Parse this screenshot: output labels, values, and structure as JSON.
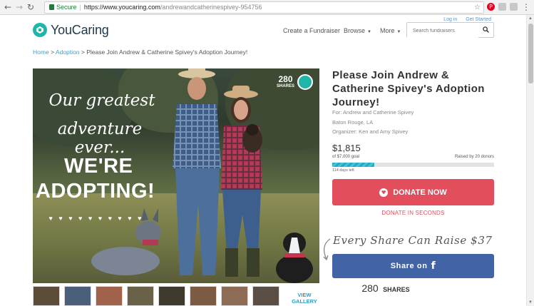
{
  "browser": {
    "secure_label": "Secure",
    "url_host": "https://www.youcaring.com",
    "url_path": "/andrewandcatherinespivey-954756"
  },
  "header": {
    "login": "Log in",
    "get_started": "Get Started",
    "logo_text": "YouCaring",
    "nav": {
      "create": "Create a Fundraiser",
      "browse": "Browse",
      "more": "More"
    },
    "search_placeholder": "Search fundraisers"
  },
  "breadcrumb": {
    "home": "Home",
    "category": "Adoption",
    "current": "Please Join Andrew & Catherine Spivey's Adoption Journey!"
  },
  "hero": {
    "script_line1": "Our greatest",
    "script_line2": "adventure ever...",
    "hearts": "♥ ♥ ♥ ♥ ♥ ♥ ♥ ♥ ♥ ♥",
    "big_line1": "WE'RE",
    "big_line2": "ADOPTING!",
    "share_count": "280",
    "share_label": "SHARES"
  },
  "gallery": {
    "view_line1": "VIEW",
    "view_line2": "GALLERY"
  },
  "fundraiser": {
    "title": "Please Join Andrew & Catherine Spivey's Adoption Journey!",
    "for": "For: Andrew and Catherine Spivey",
    "location": "Baton Rouge, LA",
    "organizer": "Organizer: Ken and Amy Spivey",
    "raised": "$1,815",
    "goal": "of $7,000 goal",
    "donors": "Raised by 20 donors",
    "progress_fraction": 0.26,
    "days_left": "114 days left",
    "donate_label": "DONATE NOW",
    "donate_seconds": "DONATE IN SECONDS",
    "every_share": "Every Share Can Raise $37",
    "share_on": "Share on",
    "share_icon": "f",
    "shares_number": "280",
    "shares_label": "SHARES"
  },
  "colors": {
    "brand_teal": "#1fb6a8",
    "donate_red": "#e24e5c",
    "facebook_blue": "#4263a5",
    "link_blue": "#3ea0c8"
  }
}
